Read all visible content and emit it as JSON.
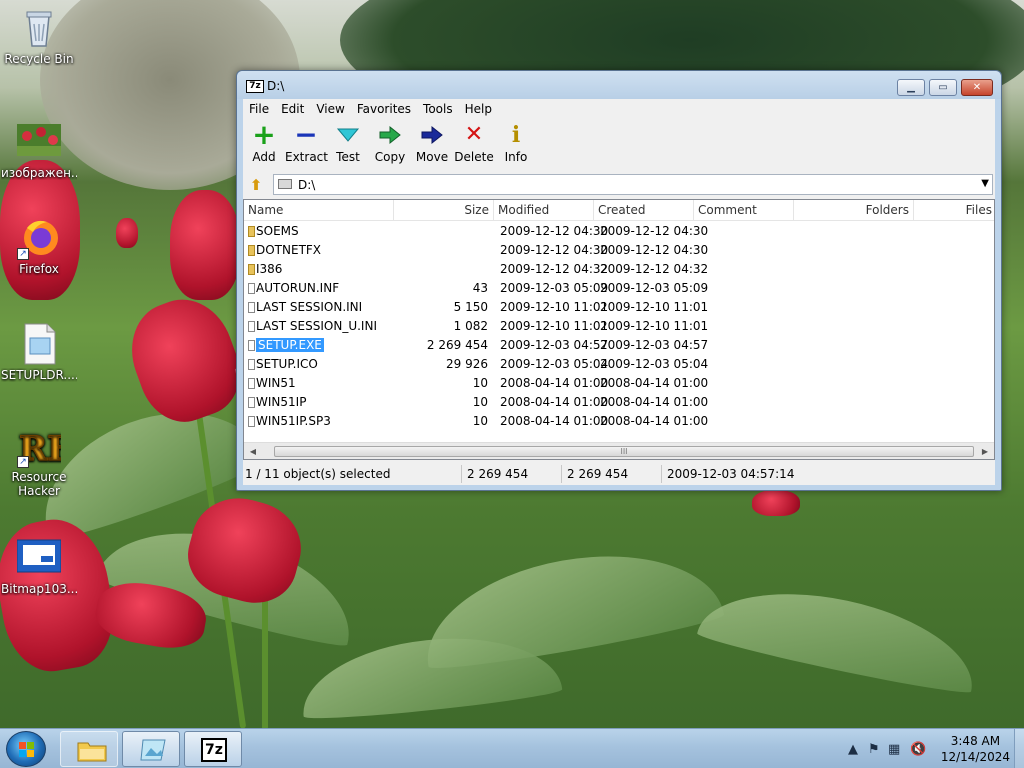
{
  "desktop": {
    "icons": [
      {
        "label": "Recycle Bin",
        "icon": "recycle-bin-icon"
      },
      {
        "label": "изображен...",
        "icon": "image-file-icon"
      },
      {
        "label": "Firefox",
        "icon": "firefox-icon"
      },
      {
        "label": "SETUPLDR....",
        "icon": "file-icon"
      },
      {
        "label": "Resource Hacker",
        "icon": "resource-hacker-icon"
      },
      {
        "label": "Bitmap103....",
        "icon": "bitmap-icon"
      }
    ]
  },
  "window": {
    "icon_text": "7z",
    "title": "D:\\",
    "menu": [
      "File",
      "Edit",
      "View",
      "Favorites",
      "Tools",
      "Help"
    ],
    "toolbar": [
      {
        "label": "Add",
        "icon": "add-icon",
        "glyph": "+",
        "color": "#1aa11a"
      },
      {
        "label": "Extract",
        "icon": "extract-icon",
        "glyph": "−",
        "color": "#1a35b8"
      },
      {
        "label": "Test",
        "icon": "test-icon",
        "glyph": "✓",
        "color": "#1fb7c4"
      },
      {
        "label": "Copy",
        "icon": "copy-icon",
        "glyph": "➜",
        "color": "#1aa13a"
      },
      {
        "label": "Move",
        "icon": "move-icon",
        "glyph": "➜",
        "color": "#1a2a9a"
      },
      {
        "label": "Delete",
        "icon": "delete-icon",
        "glyph": "✕",
        "color": "#d41414"
      },
      {
        "label": "Info",
        "icon": "info-icon",
        "glyph": "i",
        "color": "#b58f00"
      }
    ],
    "address": "D:\\",
    "columns": [
      "Name",
      "Size",
      "Modified",
      "Created",
      "Comment",
      "Folders",
      "Files"
    ],
    "rows": [
      {
        "name": "SOEMS",
        "type": "folder",
        "size": "",
        "modified": "2009-12-12 04:30",
        "created": "2009-12-12 04:30"
      },
      {
        "name": "DOTNETFX",
        "type": "folder",
        "size": "",
        "modified": "2009-12-12 04:30",
        "created": "2009-12-12 04:30"
      },
      {
        "name": "I386",
        "type": "folder",
        "size": "",
        "modified": "2009-12-12 04:32",
        "created": "2009-12-12 04:32"
      },
      {
        "name": "AUTORUN.INF",
        "type": "file",
        "size": "43",
        "modified": "2009-12-03 05:09",
        "created": "2009-12-03 05:09"
      },
      {
        "name": "LAST SESSION.INI",
        "type": "file",
        "size": "5 150",
        "modified": "2009-12-10 11:01",
        "created": "2009-12-10 11:01"
      },
      {
        "name": "LAST SESSION_U.INI",
        "type": "file",
        "size": "1 082",
        "modified": "2009-12-10 11:01",
        "created": "2009-12-10 11:01"
      },
      {
        "name": "SETUP.EXE",
        "type": "file",
        "size": "2 269 454",
        "modified": "2009-12-03 04:57",
        "created": "2009-12-03 04:57",
        "selected": true
      },
      {
        "name": "SETUP.ICO",
        "type": "file",
        "size": "29 926",
        "modified": "2009-12-03 05:04",
        "created": "2009-12-03 05:04"
      },
      {
        "name": "WIN51",
        "type": "file",
        "size": "10",
        "modified": "2008-04-14 01:00",
        "created": "2008-04-14 01:00"
      },
      {
        "name": "WIN51IP",
        "type": "file",
        "size": "10",
        "modified": "2008-04-14 01:00",
        "created": "2008-04-14 01:00"
      },
      {
        "name": "WIN51IP.SP3",
        "type": "file",
        "size": "10",
        "modified": "2008-04-14 01:00",
        "created": "2008-04-14 01:00"
      }
    ],
    "status": {
      "selection": "1 / 11 object(s) selected",
      "size": "2 269 454",
      "packed": "2 269 454",
      "date": "2009-12-03 04:57:14"
    },
    "scroll_thumb": "III"
  },
  "taskbar": {
    "clock_time": "3:48 AM",
    "clock_date": "12/14/2024",
    "pinned": [
      "explorer-icon",
      "image-viewer-icon",
      "7zip-icon"
    ],
    "seven_zip_label": "7z"
  }
}
